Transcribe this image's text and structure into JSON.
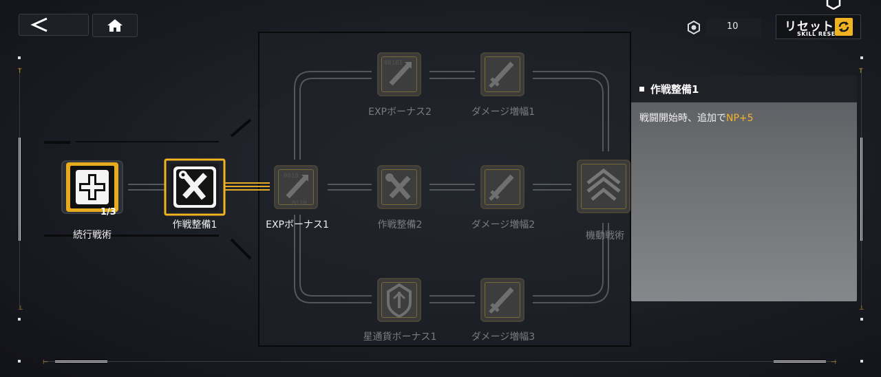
{
  "header": {
    "back_icon": "back-chevron-icon",
    "home_icon": "home-icon",
    "currency_icon": "hex-chip-icon",
    "currency_value": "10",
    "reset_label": "リセット",
    "reset_sub_label": "SKILL RESET",
    "reset_icon": "refresh-icon"
  },
  "colors": {
    "accent": "#f0b423",
    "dim_text": "#7a7c82",
    "panel_bg": "#6a6c70"
  },
  "root": {
    "label": "続行戦術",
    "level": "1/3",
    "icon": "medical-cross-icon"
  },
  "nodes": {
    "prep1": {
      "label": "作戦整備1",
      "icon": "wrench-sword-icon"
    },
    "exp1": {
      "label": "EXPボーナス1",
      "icon": "exp-arrow-icon"
    },
    "exp2": {
      "label": "EXPボーナス2",
      "icon": "exp-arrow-icon"
    },
    "dmg1": {
      "label": "ダメージ増幅1",
      "icon": "sword-icon"
    },
    "prep2": {
      "label": "作戦整備2",
      "icon": "wrench-sword-icon"
    },
    "dmg2": {
      "label": "ダメージ増幅2",
      "icon": "sword-icon"
    },
    "mobile": {
      "label": "機動戦術",
      "icon": "chevron-up-icon"
    },
    "star1": {
      "label": "星通貨ボーナス1",
      "icon": "shield-crest-icon"
    },
    "dmg3": {
      "label": "ダメージ増幅3",
      "icon": "sword-icon"
    }
  },
  "detail": {
    "title": "作戦整備1",
    "desc_prefix": "戦闘開始時、追加で",
    "desc_value": "NP+5"
  }
}
